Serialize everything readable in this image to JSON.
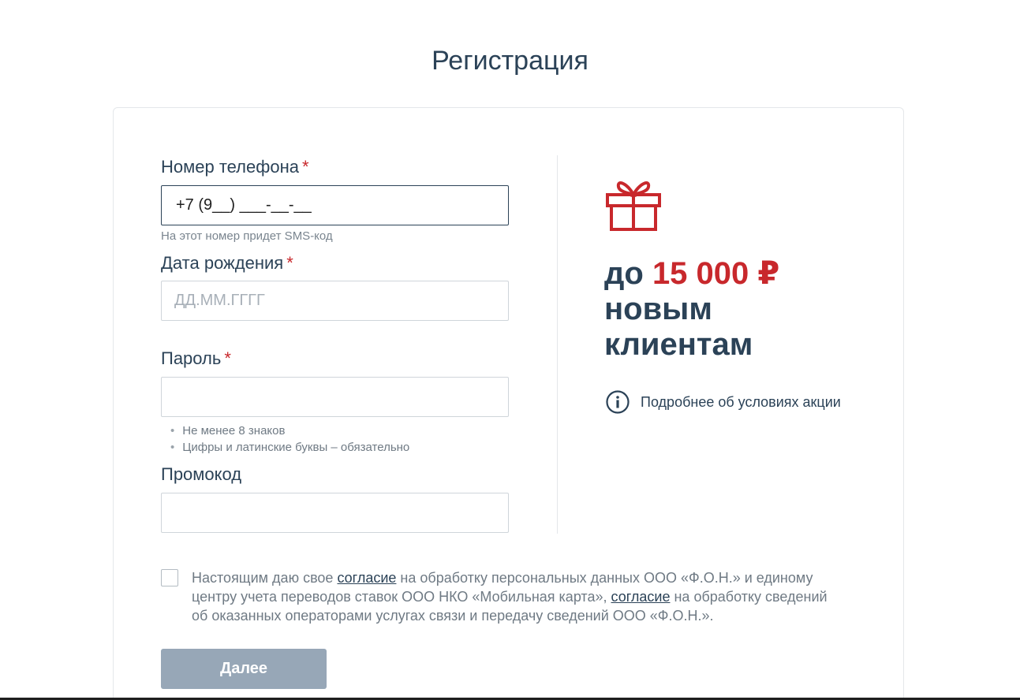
{
  "page": {
    "title": "Регистрация"
  },
  "form": {
    "phone": {
      "label": "Номер телефона",
      "required_mark": "*",
      "value": "+7 (9__) ___-__-__",
      "hint": "На этот номер придет SMS-код"
    },
    "birthdate": {
      "label": "Дата рождения",
      "required_mark": "*",
      "placeholder": "ДД.ММ.ГГГГ",
      "value": ""
    },
    "password": {
      "label": "Пароль",
      "required_mark": "*",
      "value": "",
      "rules": [
        "Не менее 8 знаков",
        "Цифры и латинские буквы – обязательно"
      ]
    },
    "promocode": {
      "label": "Промокод",
      "value": ""
    },
    "consent": {
      "checked": false,
      "text_part1": "Настоящим даю свое ",
      "link1": "согласие",
      "text_part2": " на обработку персональных данных ООО «Ф.О.Н.» и единому центру учета переводов ставок ООО НКО «Мобильная карта», ",
      "link2": "согласие",
      "text_part3": " на обработку сведений об оказанных операторами услугах связи и передачу сведений ООО «Ф.О.Н.»."
    },
    "submit_label": "Далее"
  },
  "promo": {
    "icon": "gift-icon",
    "prefix": "до ",
    "amount": "15 000 ₽",
    "line2": "новым",
    "line3": "клиентам",
    "info_icon": "info-icon",
    "info_link": "Подробнее об условиях акции"
  },
  "colors": {
    "primary_text": "#2b4257",
    "accent_red": "#c8282c",
    "button_disabled": "#97a7b7",
    "border": "#cfd5da"
  }
}
